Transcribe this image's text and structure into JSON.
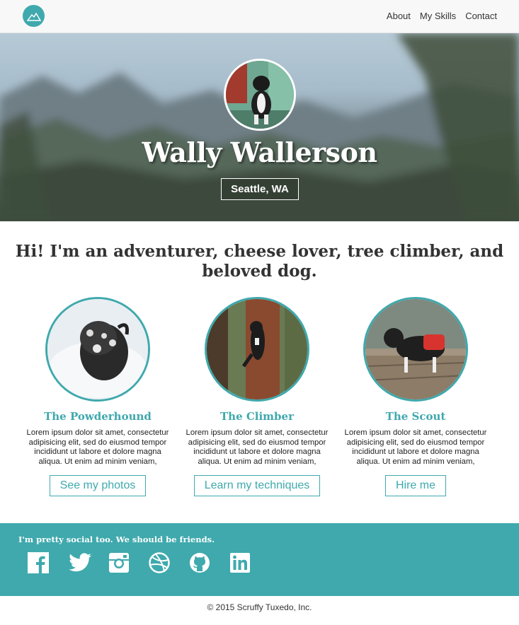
{
  "nav": {
    "logo_icon": "mountain-logo-icon",
    "items": [
      {
        "label": "About"
      },
      {
        "label": "My Skills"
      },
      {
        "label": "Contact"
      }
    ]
  },
  "hero": {
    "name": "Wally Wallerson",
    "location": "Seattle, WA"
  },
  "intro": {
    "headline": "Hi! I'm an adventurer, cheese lover, tree climber, and beloved dog."
  },
  "features": [
    {
      "title": "The Powderhound",
      "text": "Lorem ipsum dolor sit amet, consectetur adipisicing elit, sed do eiusmod tempor incididunt ut labore et dolore magna aliqua. Ut enim ad minim veniam,",
      "button": "See my photos"
    },
    {
      "title": "The Climber",
      "text": "Lorem ipsum dolor sit amet, consectetur adipisicing elit, sed do eiusmod tempor incididunt ut labore et dolore magna aliqua. Ut enim ad minim veniam,",
      "button": "Learn my techniques"
    },
    {
      "title": "The Scout",
      "text": "Lorem ipsum dolor sit amet, consectetur adipisicing elit, sed do eiusmod tempor incididunt ut labore et dolore magna aliqua. Ut enim ad minim veniam,",
      "button": "Hire me"
    }
  ],
  "social": {
    "message": "I'm pretty social too. We should be friends.",
    "icons": [
      "facebook-icon",
      "twitter-icon",
      "instagram-icon",
      "dribbble-icon",
      "github-icon",
      "linkedin-icon"
    ]
  },
  "footer": {
    "copyright": "© 2015 Scruffy Tuxedo, Inc."
  },
  "colors": {
    "accent": "#3fa9ad",
    "nav_bg": "#f8f8f8"
  }
}
